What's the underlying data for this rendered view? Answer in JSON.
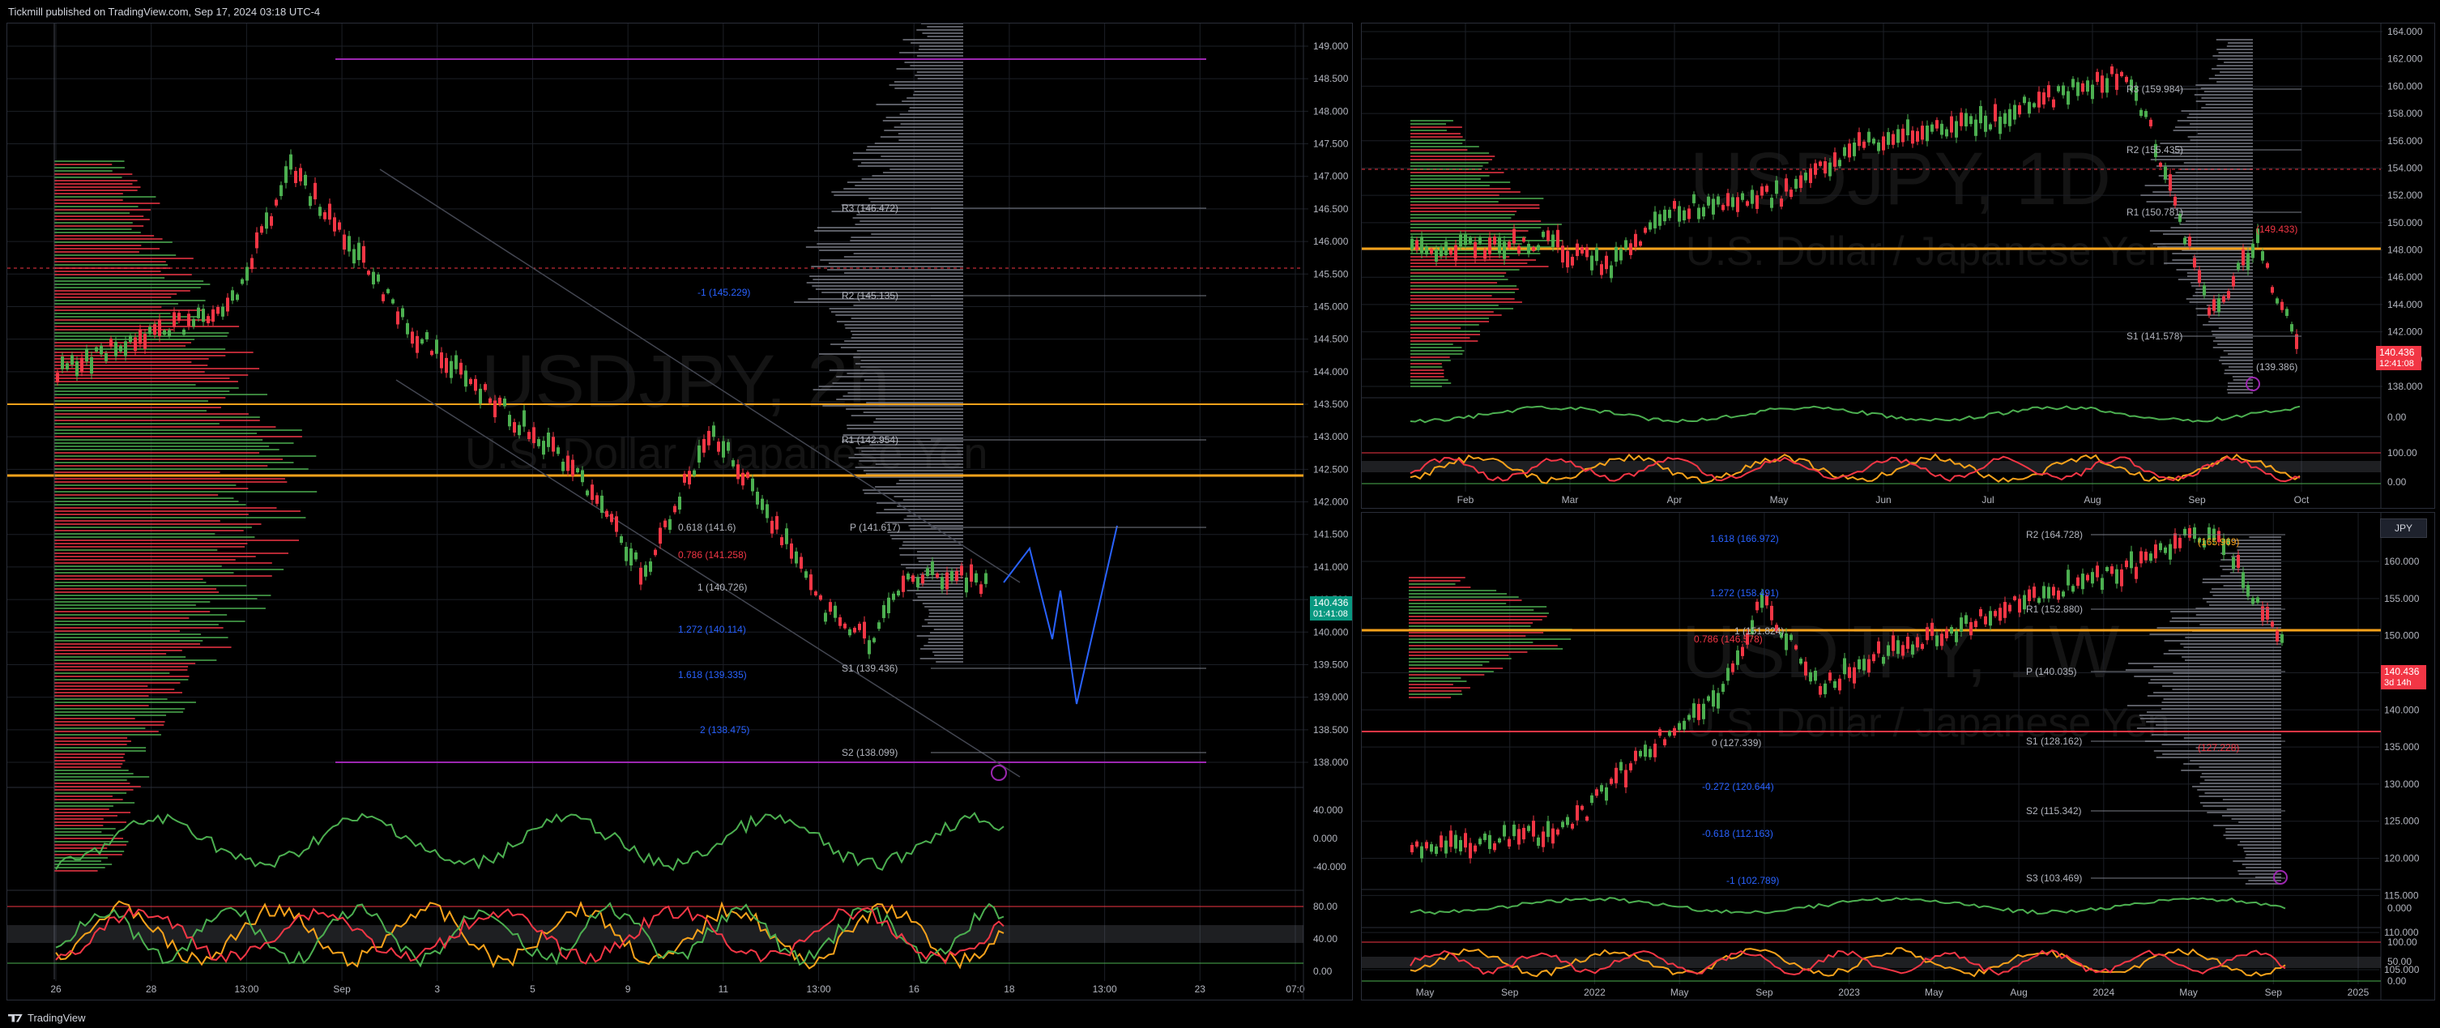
{
  "header": {
    "publisher_text": "Tickmill published on TradingView.com, Sep 17, 2024 03:18 UTC-4"
  },
  "footer": {
    "brand": "TradingView"
  },
  "colors": {
    "bull": "#4caf50",
    "bear": "#f23645",
    "orange": "#f7a21b",
    "purple": "#9c27b0",
    "blue": "#2962ff",
    "grid": "#1c1f26"
  },
  "main_chart": {
    "watermark_symbol": "USDJPY, 2h",
    "watermark_name": "U.S. Dollar / Japanese Yen",
    "price_ticks": [
      "149.000",
      "148.500",
      "148.000",
      "147.500",
      "147.000",
      "146.500",
      "146.000",
      "145.500",
      "145.000",
      "144.500",
      "144.000",
      "143.500",
      "143.000",
      "142.500",
      "142.000",
      "141.500",
      "141.000",
      "140.500",
      "140.000",
      "139.500",
      "139.000",
      "138.500",
      "138.000"
    ],
    "last_price": "140.436",
    "countdown": "01:41:08",
    "time_ticks": [
      "26",
      "28",
      "13:00",
      "Sep",
      "3",
      "5",
      "9",
      "11",
      "13:00",
      "16",
      "18",
      "13:00",
      "23",
      "07:0"
    ],
    "pivot_labels": [
      "R3 (146.472)",
      "R2 (145.135)",
      "R1 (142.954)",
      "P (141.617)",
      "S1 (139.436)",
      "S2 (138.099)"
    ],
    "fib_labels": [
      "-1 (145.229)",
      "0.786 (141.258)",
      "1 (140.726)",
      "1.272 (140.114)",
      "1.618 (139.335)",
      "2 (138.475)",
      "0.618 (141.6)"
    ],
    "osc1_ticks": [
      "40.000",
      "0.000",
      "-40.000"
    ],
    "osc2_ticks": [
      "80.00",
      "40.00",
      "0.00"
    ]
  },
  "daily_chart": {
    "watermark_symbol": "USDJPY, 1D",
    "watermark_name": "U.S. Dollar / Japanese Yen",
    "price_ticks": [
      "164.000",
      "162.000",
      "160.000",
      "158.000",
      "156.000",
      "154.000",
      "152.000",
      "150.000",
      "148.000",
      "146.000",
      "144.000",
      "142.000",
      "140.000",
      "138.000"
    ],
    "last_price": "140.436",
    "countdown": "12:41:08",
    "time_ticks": [
      "Feb",
      "Mar",
      "Apr",
      "May",
      "Jun",
      "Jul",
      "Aug",
      "Sep",
      "Oct"
    ],
    "pivot_labels": [
      "R3 (159.984)",
      "R2 (155.435)",
      "R1 (150.781)",
      "S1 (141.578)"
    ],
    "other_labels": [
      "(149.433)",
      "(139.386)"
    ],
    "osc1_ticks": [
      "0.00"
    ],
    "osc2_ticks": [
      "100.00",
      "0.00"
    ]
  },
  "weekly_chart": {
    "watermark_symbol": "USDJPY, 1W",
    "watermark_name": "U.S. Dollar / Japanese Yen",
    "currency_button": "JPY",
    "price_ticks": [
      "160.000",
      "155.000",
      "150.000",
      "145.000",
      "140.000",
      "135.000",
      "130.000",
      "125.000",
      "120.000",
      "115.000",
      "110.000",
      "105.000"
    ],
    "last_price": "140.436",
    "countdown": "3d 14h",
    "time_ticks": [
      "May",
      "Sep",
      "2022",
      "May",
      "Sep",
      "2023",
      "May",
      "Aug",
      "2024",
      "May",
      "Sep",
      "2025"
    ],
    "pivot_labels": [
      "R2 (164.728)",
      "R1 (152.880)",
      "P (140.035)",
      "S1 (128.162)",
      "S2 (115.342)",
      "S3 (103.469)"
    ],
    "fib_labels": [
      "1.618 (166.972)",
      "1.272 (158.491)",
      "1 (151.824)",
      "0.786 (146.578)",
      "0 (127.339)",
      "-0.272 (120.644)",
      "-0.618 (112.163)",
      "-1 (102.789)"
    ],
    "other_labels": [
      "(165.969)",
      "(127.228)"
    ],
    "osc1_ticks": [
      "0.000"
    ],
    "osc2_ticks": [
      "100.00",
      "50.00",
      "0.00"
    ]
  }
}
